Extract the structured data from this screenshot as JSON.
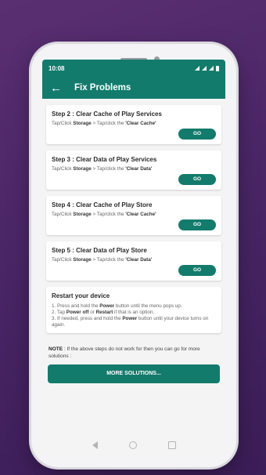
{
  "status": {
    "time": "10:08"
  },
  "appbar": {
    "title": "Fix Problems"
  },
  "steps": [
    {
      "title": "Step 2 : Clear Cache of Play Services",
      "prefix": "Tap/Click ",
      "bold1": "Storage",
      "mid": " > Tap/click the ",
      "bold2": "'Clear Cache'",
      "button": "GO"
    },
    {
      "title": "Step 3 : Clear Data of Play Services",
      "prefix": "Tap/Click ",
      "bold1": "Storage",
      "mid": " > Tap/click the ",
      "bold2": "'Clear Data'",
      "button": "GO"
    },
    {
      "title": "Step 4 : Clear Cache of Play Store",
      "prefix": "Tap/Click ",
      "bold1": "Storage",
      "mid": " > Tap/click the ",
      "bold2": "'Clear Cache'",
      "button": "GO"
    },
    {
      "title": "Step 5 : Clear Data of Play Store",
      "prefix": "Tap/Click ",
      "bold1": "Storage",
      "mid": " > Tap/click the ",
      "bold2": "'Clear Data'",
      "button": "GO"
    }
  ],
  "restart": {
    "title": "Restart your device",
    "l1a": "1. Press and hold the ",
    "l1b": "Power",
    "l1c": " button until the menu pops up.",
    "l2a": "2. Tap ",
    "l2b": "Power off",
    "l2c": " or ",
    "l2d": "Restart",
    "l2e": " if that is an option.",
    "l3a": "3. If needed, press and hold the ",
    "l3b": "Power",
    "l3c": " button until your device turns on again."
  },
  "note": {
    "label": "NOTE",
    "text": " : If the above steps do not work for then you can go for more solutions :"
  },
  "more_button": "MORE SOLUTIONS..."
}
